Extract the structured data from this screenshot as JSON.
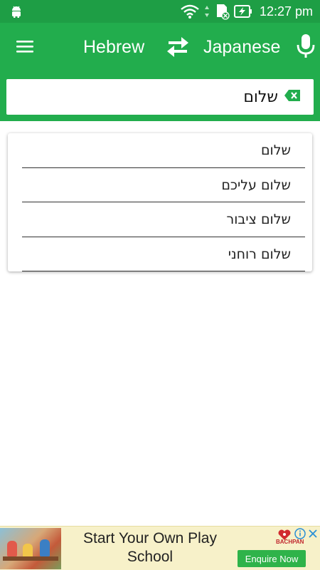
{
  "status_bar": {
    "time": "12:27 pm",
    "icons": [
      "android-icon",
      "wifi-icon",
      "sd-card-icon",
      "battery-charging-icon"
    ]
  },
  "app_bar": {
    "menu_icon": "hamburger-menu-icon",
    "source_language": "Hebrew",
    "swap_icon": "swap-arrows-icon",
    "target_language": "Japanese",
    "mic_icon": "microphone-icon"
  },
  "search": {
    "value": "שלום",
    "clear_icon": "backspace-clear-icon"
  },
  "suggestions": [
    {
      "text": "שלום"
    },
    {
      "text": "שלום עליכם"
    },
    {
      "text": "שלום ציבור"
    },
    {
      "text": "שלום רוחני"
    }
  ],
  "ad": {
    "title": "Start Your Own Play School",
    "cta": "Enquire Now",
    "brand": "BACHPAN"
  },
  "colors": {
    "status_bar": "#1e9e45",
    "app_bar": "#22ad4d",
    "ad_background": "#f7f1c9",
    "cta": "#2fb34a"
  }
}
